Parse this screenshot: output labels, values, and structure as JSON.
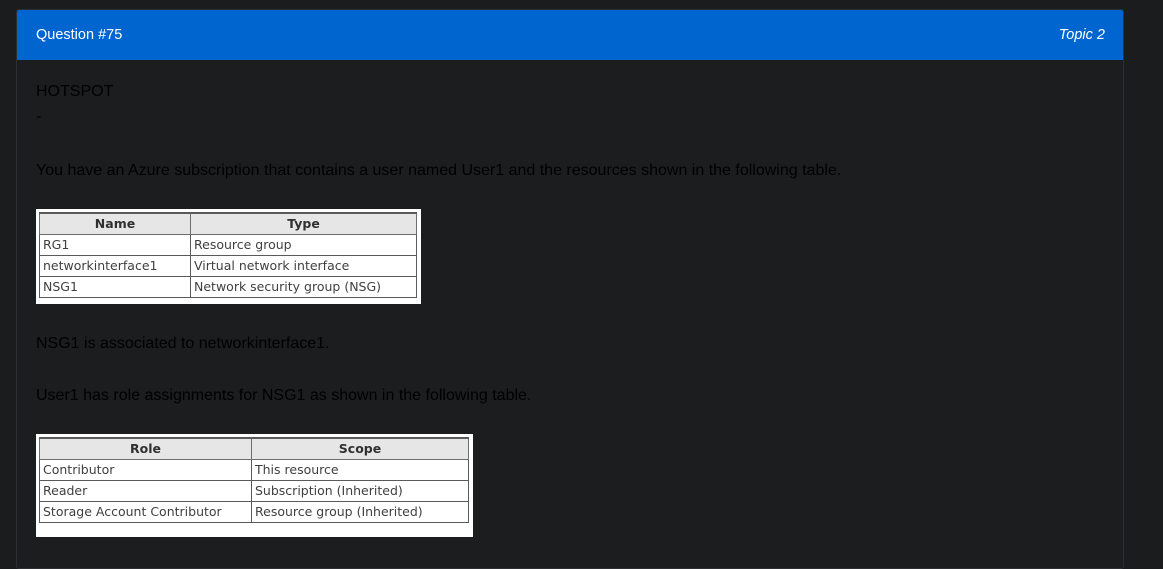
{
  "header": {
    "question": "Question #75",
    "topic": "Topic 2"
  },
  "body": {
    "type_label": "HOTSPOT",
    "dash": "-",
    "intro": "You have an Azure subscription that contains a user named User1 and the resources shown in the following table.",
    "resources_table": {
      "headers": [
        "Name",
        "Type"
      ],
      "rows": [
        [
          "RG1",
          "Resource group"
        ],
        [
          "networkinterface1",
          "Virtual network interface"
        ],
        [
          "NSG1",
          "Network security group (NSG)"
        ]
      ]
    },
    "association": "NSG1 is associated to networkinterface1.",
    "roles_intro": "User1 has role assignments for NSG1 as shown in the following table.",
    "roles_table": {
      "headers": [
        "Role",
        "Scope"
      ],
      "rows": [
        [
          "Contributor",
          "This resource"
        ],
        [
          "Reader",
          "Subscription (Inherited)"
        ],
        [
          "Storage Account Contributor",
          "Resource group (Inherited)"
        ]
      ]
    }
  }
}
